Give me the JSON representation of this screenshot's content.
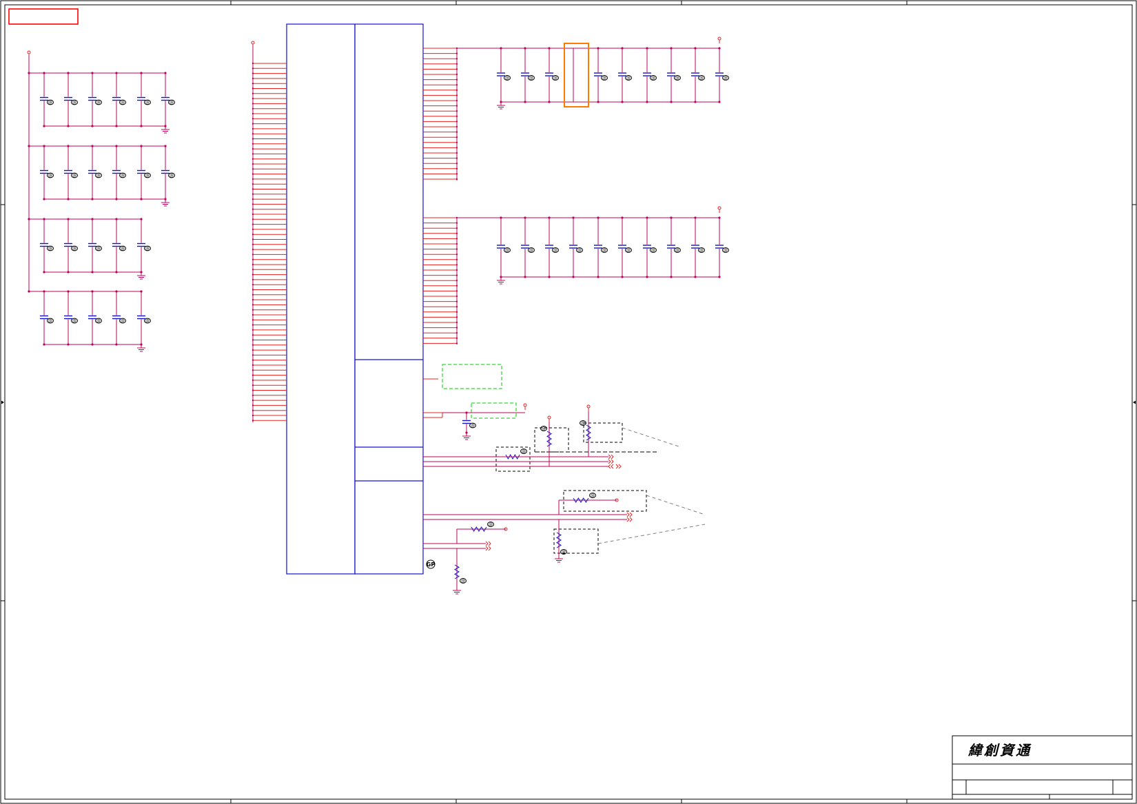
{
  "title_block": {
    "company": "緯創資通"
  },
  "labels": {
    "gp": "GP",
    "pad": "@"
  },
  "colors": {
    "frame": "#000000",
    "wire": "#c0005a",
    "pin": "#e8201e",
    "component": "#1010d0",
    "power_pin": "#e02020",
    "highlight": "#ff7a00",
    "annotation": "#00cc00",
    "callout": "#000000",
    "tag": "#ff0000"
  }
}
